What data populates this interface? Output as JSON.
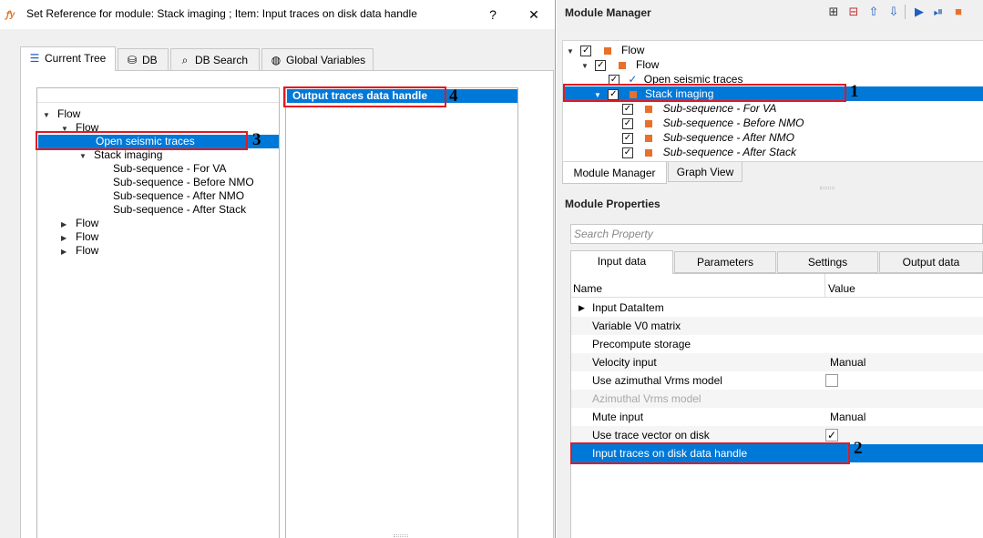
{
  "dialog": {
    "title": "Set Reference for module: Stack imaging ; Item: Input traces on disk data handle",
    "help_label": "?",
    "close_label": "✕",
    "tabs": [
      {
        "label": "Current Tree",
        "icon": "tree-icon"
      },
      {
        "label": "DB",
        "icon": "database-icon"
      },
      {
        "label": "DB Search",
        "icon": "search-icon"
      },
      {
        "label": "Global Variables",
        "icon": "globe-icon"
      }
    ],
    "tree": [
      "Flow",
      "Flow",
      "Open seismic traces",
      "Stack imaging",
      "Sub-sequence - For VA",
      "Sub-sequence - Before NMO",
      "Sub-sequence - After NMO",
      "Sub-sequence - After Stack",
      "Flow",
      "Flow",
      "Flow"
    ],
    "reference_item": "Output traces data handle"
  },
  "module_manager": {
    "title": "Module Manager",
    "toolbar_icons": [
      "add-module-icon",
      "remove-module-icon",
      "move-up-icon",
      "move-down-icon",
      "run-icon",
      "run-step-icon",
      "stop-icon"
    ],
    "tree": [
      {
        "label": "Flow",
        "checked": true,
        "kind": "square"
      },
      {
        "label": "Flow",
        "checked": true,
        "kind": "square"
      },
      {
        "label": "Open seismic traces",
        "checked": true,
        "kind": "tick"
      },
      {
        "label": "Stack imaging",
        "checked": true,
        "kind": "square"
      },
      {
        "label": "Sub-sequence - For VA",
        "checked": true,
        "kind": "square"
      },
      {
        "label": "Sub-sequence - Before NMO",
        "checked": true,
        "kind": "square"
      },
      {
        "label": "Sub-sequence - After NMO",
        "checked": true,
        "kind": "square"
      },
      {
        "label": "Sub-sequence - After Stack",
        "checked": true,
        "kind": "square"
      }
    ],
    "tabs": [
      "Module Manager",
      "Graph View"
    ]
  },
  "module_properties": {
    "title": "Module Properties",
    "search_placeholder": "Search Property",
    "tabs": [
      "Input data",
      "Parameters",
      "Settings",
      "Output data"
    ],
    "columns": [
      "Name",
      "Value"
    ],
    "rows": [
      {
        "name": "Input DataItem",
        "value": ""
      },
      {
        "name": "Variable V0 matrix",
        "value": ""
      },
      {
        "name": "Precompute storage",
        "value": ""
      },
      {
        "name": "Velocity input",
        "value": "Manual"
      },
      {
        "name": "Use azimuthal Vrms model",
        "value": ""
      },
      {
        "name": "Azimuthal Vrms model",
        "value": ""
      },
      {
        "name": "Mute input",
        "value": "Manual"
      },
      {
        "name": "Use trace vector on disk",
        "value": ""
      },
      {
        "name": "Input traces on disk data handle",
        "value": ""
      }
    ],
    "checkbox_values": {
      "use_azimuthal": false,
      "use_trace_vector": true
    }
  },
  "markers": [
    "1",
    "2",
    "3",
    "4"
  ],
  "colors": {
    "selection": "#0078d7",
    "highlight_box": "#e01a22",
    "module_square": "#e8702a"
  }
}
